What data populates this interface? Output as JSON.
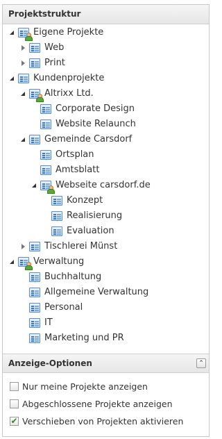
{
  "panel": {
    "title": "Projektstruktur"
  },
  "tree": [
    {
      "label": "Eigene Projekte",
      "icon": "project-group-user-icon",
      "expander": "open"
    },
    {
      "label": "Web",
      "icon": "project-icon",
      "expander": "closed"
    },
    {
      "label": "Print",
      "icon": "project-icon",
      "expander": "closed"
    },
    {
      "label": "Kundenprojekte",
      "icon": "project-icon",
      "expander": "open"
    },
    {
      "label": "Altrixx Ltd.",
      "icon": "project-group-user-icon",
      "expander": "open"
    },
    {
      "label": "Corporate Design",
      "icon": "project-icon",
      "expander": "none"
    },
    {
      "label": "Website Relaunch",
      "icon": "project-icon",
      "expander": "none"
    },
    {
      "label": "Gemeinde Carsdorf",
      "icon": "project-icon",
      "expander": "open"
    },
    {
      "label": "Ortsplan",
      "icon": "project-icon",
      "expander": "none"
    },
    {
      "label": "Amtsblatt",
      "icon": "project-icon",
      "expander": "none"
    },
    {
      "label": "Webseite carsdorf.de",
      "icon": "project-group-user-icon",
      "expander": "open"
    },
    {
      "label": "Konzept",
      "icon": "project-icon",
      "expander": "none"
    },
    {
      "label": "Realisierung",
      "icon": "project-icon",
      "expander": "none"
    },
    {
      "label": "Evaluation",
      "icon": "project-icon",
      "expander": "none"
    },
    {
      "label": "Tischlerei Münst",
      "icon": "project-icon",
      "expander": "closed"
    },
    {
      "label": "Verwaltung",
      "icon": "project-group-user-icon",
      "expander": "open"
    },
    {
      "label": "Buchhaltung",
      "icon": "project-icon",
      "expander": "none"
    },
    {
      "label": "Allgemeine Verwaltung",
      "icon": "project-icon",
      "expander": "none"
    },
    {
      "label": "Personal",
      "icon": "project-icon",
      "expander": "none"
    },
    {
      "label": "IT",
      "icon": "project-icon",
      "expander": "none"
    },
    {
      "label": "Marketing und PR",
      "icon": "project-icon",
      "expander": "none"
    }
  ],
  "options": {
    "title": "Anzeige-Optionen",
    "collapse_icon": "double-chevron-up-icon",
    "items": [
      {
        "label": "Nur meine Projekte anzeigen",
        "checked": false
      },
      {
        "label": "Abgeschlossene Projekte anzeigen",
        "checked": false
      },
      {
        "label": "Verschieben von Projekten aktivieren",
        "checked": true
      }
    ]
  },
  "colors": {
    "header_bg": "#e9e9e9",
    "icon_blue": "#3a78c3",
    "check_green": "#2e8a1c"
  }
}
